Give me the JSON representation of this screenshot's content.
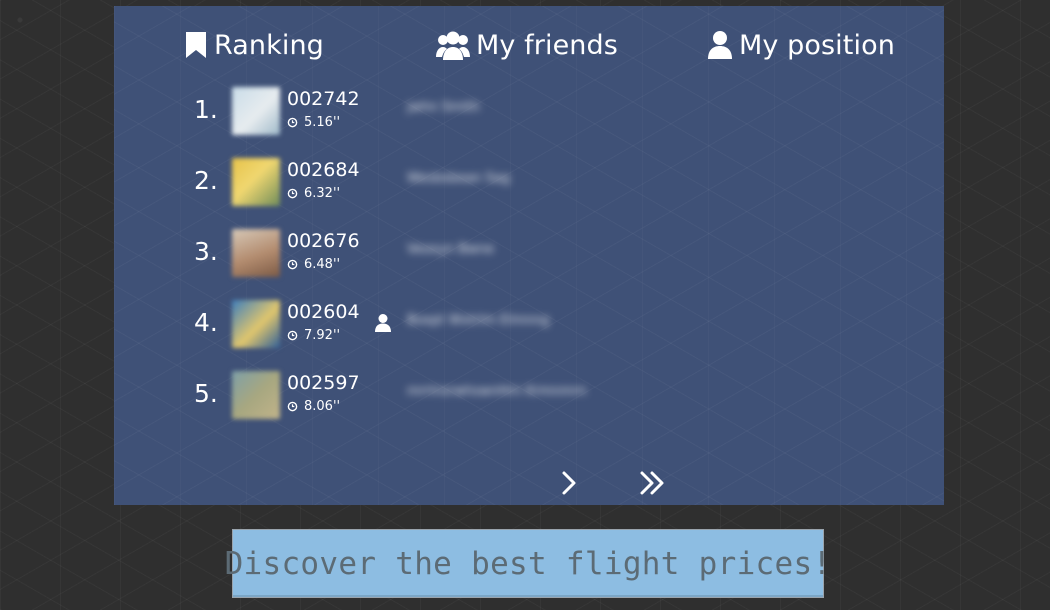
{
  "tabs": {
    "ranking": {
      "label": "Ranking",
      "icon": "bookmark-icon"
    },
    "friends": {
      "label": "My friends",
      "icon": "users-icon"
    },
    "position": {
      "label": "My position",
      "icon": "user-icon"
    }
  },
  "ranking": [
    {
      "rank": "1.",
      "score": "002742",
      "time": "5.16''",
      "name": "jwhn Smith",
      "is_me": false,
      "avatar_colors": [
        "#c9dce8",
        "#e7ecef"
      ]
    },
    {
      "rank": "2.",
      "score": "002684",
      "time": "6.32''",
      "name": "Wesbsbean Sag",
      "is_me": false,
      "avatar_colors": [
        "#e6c24a",
        "#b9a25f"
      ]
    },
    {
      "rank": "3.",
      "score": "002676",
      "time": "6.48''",
      "name": "Veoxyn Bwne",
      "is_me": false,
      "avatar_colors": [
        "#b38c6f",
        "#d7c9b8"
      ]
    },
    {
      "rank": "4.",
      "score": "002604",
      "time": "7.92''",
      "name": "Boxpt Wxtrlm Elmnng",
      "is_me": true,
      "avatar_colors": [
        "#3e7fbd",
        "#e0c66d"
      ]
    },
    {
      "rank": "5.",
      "score": "002597",
      "time": "8.06''",
      "name": "mrrlnsrwhswnHrn Krmnmrn",
      "is_me": false,
      "avatar_colors": [
        "#a7a780",
        "#7ea0a8"
      ]
    }
  ],
  "pager": {
    "next_icon": "chevron-right-icon",
    "last_icon": "double-chevron-right-icon"
  },
  "ad": {
    "text": "Discover the best flight prices!"
  },
  "colors": {
    "page_background": "#2f2f2f",
    "panel_background": "#3f5177",
    "ad_background": "#8dbde2",
    "ad_text": "#5c6b75",
    "text": "#ffffff"
  }
}
